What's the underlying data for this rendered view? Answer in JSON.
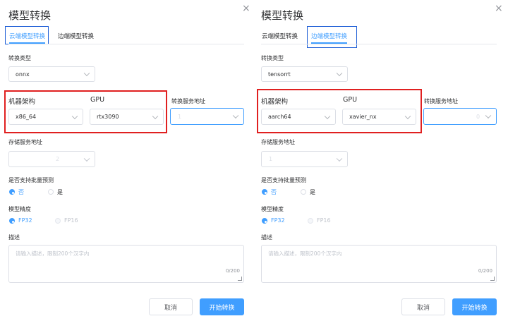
{
  "dialog_title": "模型转换",
  "close_glyph": "×",
  "tabs": {
    "cloud": "云端模型转换",
    "edge": "边端模型转换"
  },
  "labels": {
    "convert_type": "转换类型",
    "machine_arch": "机器架构",
    "gpu": "GPU",
    "convert_service": "转换服务地址",
    "storage_service": "存储服务地址",
    "batch_predict": "是否支持批量预测",
    "precision": "模型精度",
    "description": "描述"
  },
  "options": {
    "no": "否",
    "yes": "是",
    "fp32": "FP32",
    "fp16": "FP16"
  },
  "description_placeholder": "请输入描述，限制200个汉字内",
  "description_counter": "0/200",
  "buttons": {
    "cancel": "取消",
    "start": "开始转换"
  },
  "left": {
    "active_tab": "cloud",
    "convert_type": "onnx",
    "machine_arch": "x86_64",
    "gpu": "rtx3090",
    "convert_service_value": "1",
    "storage_service_value": "2",
    "batch_predict": "否",
    "precision": "FP32"
  },
  "right": {
    "active_tab": "edge",
    "convert_type": "tensorrt",
    "machine_arch": "aarch64",
    "gpu": "xavier_nx",
    "convert_service_value": "0",
    "storage_service_value": "1",
    "batch_predict": "否",
    "precision": "FP32"
  },
  "colors": {
    "primary": "#409eff",
    "highlight_red": "#e02020",
    "highlight_blue": "#1f5fd6"
  }
}
